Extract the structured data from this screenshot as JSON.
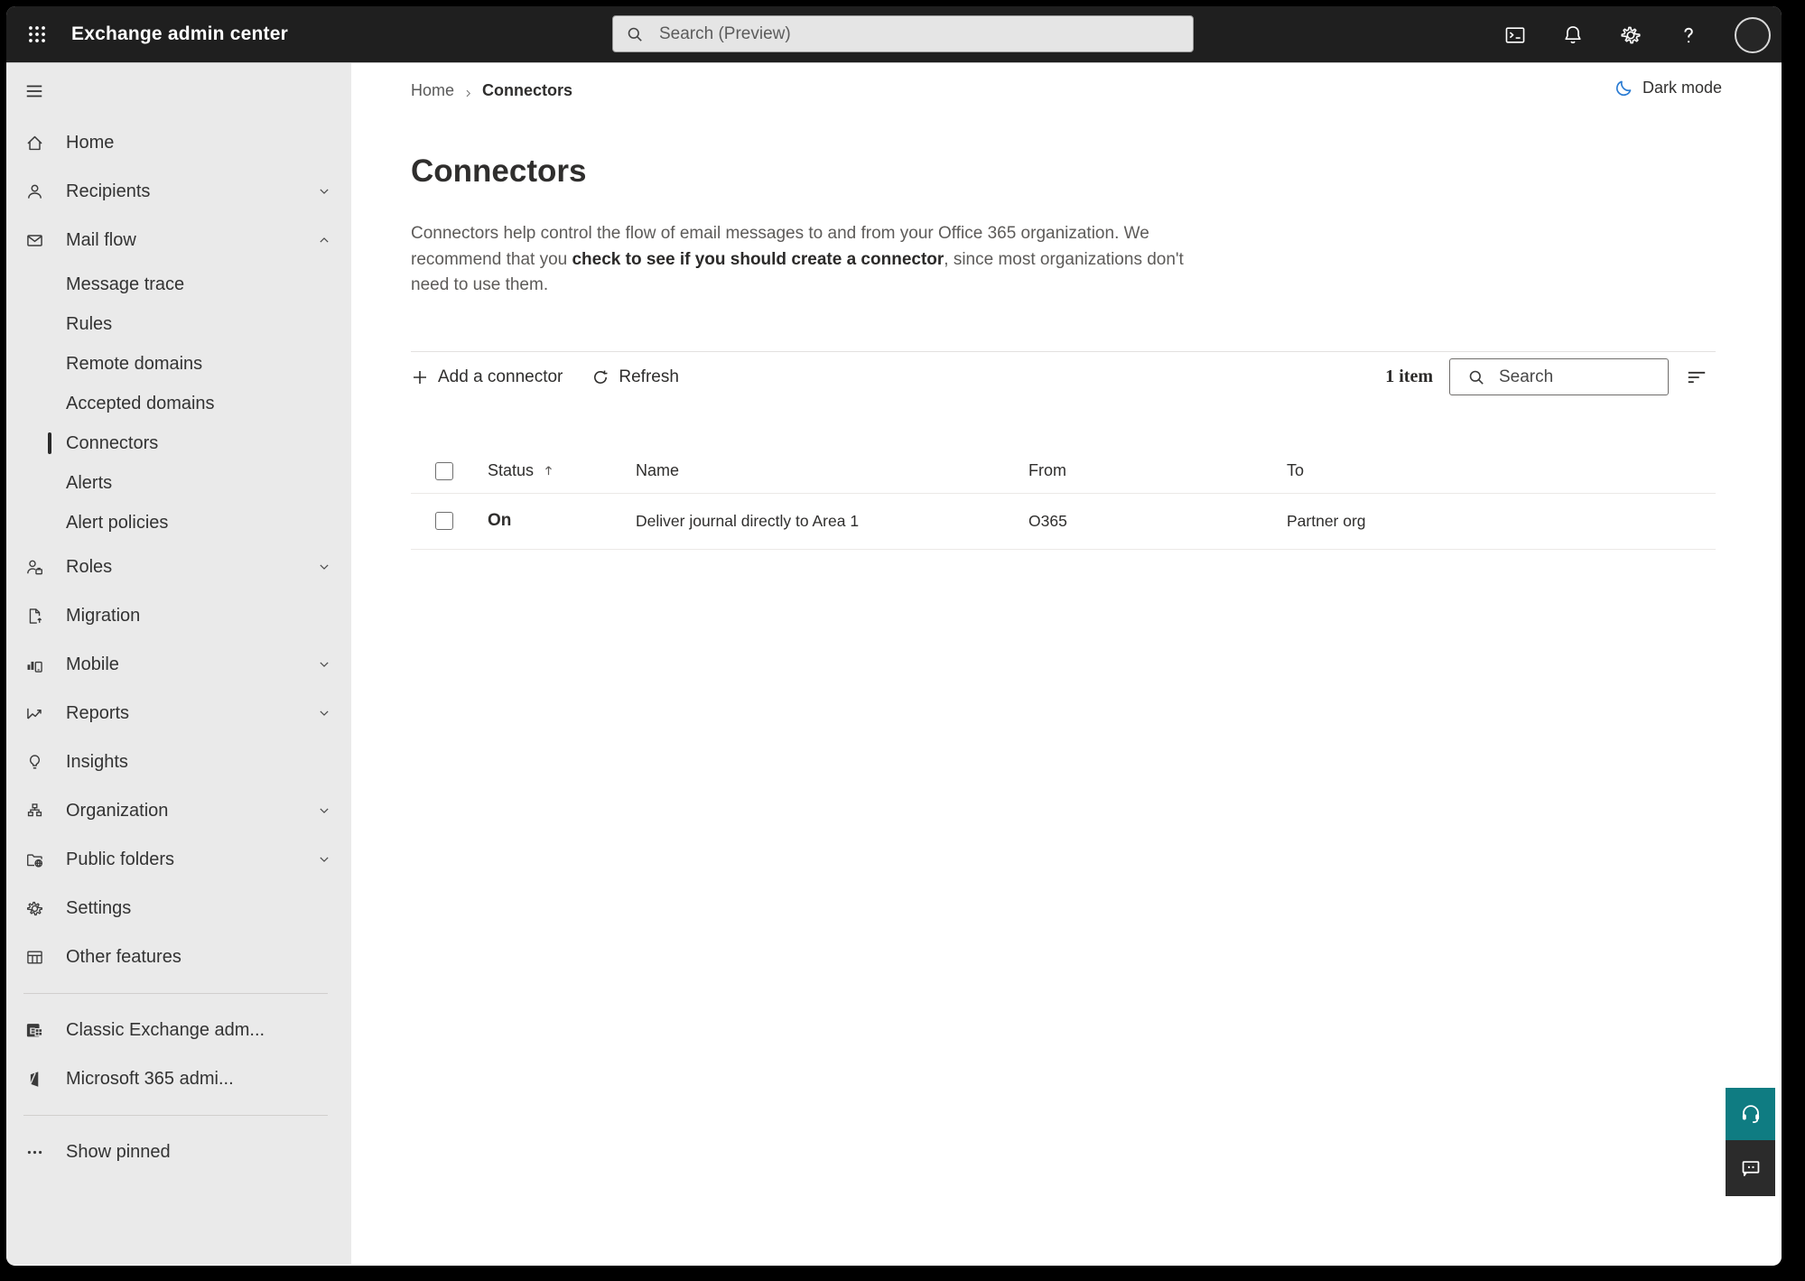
{
  "colors": {
    "topbar_bg": "#1f1f1f",
    "sidebar_bg": "#eaeaea",
    "accent_teal": "#0f7c82",
    "chat_button_bg": "#2b2b2b",
    "moon_blue": "#2b7cd3",
    "text_primary": "#323130",
    "text_secondary": "#5d5b59"
  },
  "topbar": {
    "app_launcher_icon": "waffle-icon",
    "title": "Exchange admin center",
    "search": {
      "icon": "search-icon",
      "placeholder": "Search (Preview)"
    },
    "actions": [
      {
        "icon": "terminal-icon"
      },
      {
        "icon": "bell-icon"
      },
      {
        "icon": "gear-icon"
      },
      {
        "icon": "help-icon"
      },
      {
        "icon": "avatar"
      }
    ]
  },
  "sidebar": {
    "menu_icon": "hamburger-icon",
    "items": [
      {
        "label": "Home",
        "icon": "home-icon",
        "level": "top"
      },
      {
        "label": "Recipients",
        "icon": "person-icon",
        "level": "top",
        "chevron": "down"
      },
      {
        "label": "Mail flow",
        "icon": "mail-icon",
        "level": "top",
        "chevron": "up",
        "expanded": true
      },
      {
        "label": "Message trace",
        "level": "sub"
      },
      {
        "label": "Rules",
        "level": "sub"
      },
      {
        "label": "Remote domains",
        "level": "sub"
      },
      {
        "label": "Accepted domains",
        "level": "sub"
      },
      {
        "label": "Connectors",
        "level": "sub",
        "selected": true
      },
      {
        "label": "Alerts",
        "level": "sub"
      },
      {
        "label": "Alert policies",
        "level": "sub"
      },
      {
        "label": "Roles",
        "icon": "roles-icon",
        "level": "top",
        "chevron": "down"
      },
      {
        "label": "Migration",
        "icon": "migration-icon",
        "level": "top"
      },
      {
        "label": "Mobile",
        "icon": "mobile-icon",
        "level": "top",
        "chevron": "down"
      },
      {
        "label": "Reports",
        "icon": "reports-icon",
        "level": "top",
        "chevron": "down"
      },
      {
        "label": "Insights",
        "icon": "insights-icon",
        "level": "top"
      },
      {
        "label": "Organization",
        "icon": "organization-icon",
        "level": "top",
        "chevron": "down"
      },
      {
        "label": "Public folders",
        "icon": "public-folders-icon",
        "level": "top",
        "chevron": "down"
      },
      {
        "label": "Settings",
        "icon": "settings-icon",
        "level": "top"
      },
      {
        "label": "Other features",
        "icon": "other-features-icon",
        "level": "top"
      },
      {
        "divider": true
      },
      {
        "label": "Classic Exchange adm...",
        "icon": "classic-exchange-icon",
        "level": "top"
      },
      {
        "label": "Microsoft 365 admi...",
        "icon": "microsoft-365-icon",
        "level": "top"
      },
      {
        "divider": true
      },
      {
        "label": "Show pinned",
        "icon": "more-icon",
        "level": "top"
      }
    ]
  },
  "breadcrumb": {
    "items": [
      "Home",
      "Connectors"
    ],
    "separator_icon": "chevron-right-icon"
  },
  "dark_mode": {
    "icon": "moon-icon",
    "label": "Dark mode"
  },
  "page": {
    "title": "Connectors",
    "description": {
      "before": "Connectors help control the flow of email messages to and from your Office 365 organization. We recommend that you ",
      "emphasis": "check to see if you should create a connector",
      "after": ", since most organizations don't need to use them."
    }
  },
  "toolbar": {
    "add": {
      "icon": "plus-icon",
      "label": "Add a connector"
    },
    "refresh": {
      "icon": "refresh-icon",
      "label": "Refresh"
    },
    "item_count": "1 item",
    "search": {
      "icon": "search-icon",
      "placeholder": "Search"
    },
    "filter_icon": "filter-lines-icon"
  },
  "table": {
    "columns": [
      "Status",
      "Name",
      "From",
      "To"
    ],
    "sort": {
      "column": "Status",
      "direction": "ascending",
      "icon": "sort-ascending-icon"
    },
    "rows": [
      {
        "status": "On",
        "name": "Deliver journal directly to Area 1",
        "from": "O365",
        "to": "Partner org"
      }
    ]
  },
  "floating_buttons": [
    {
      "icon": "headset-icon",
      "bg": "#0f7c82"
    },
    {
      "icon": "chat-icon",
      "bg": "#2b2b2b"
    }
  ]
}
